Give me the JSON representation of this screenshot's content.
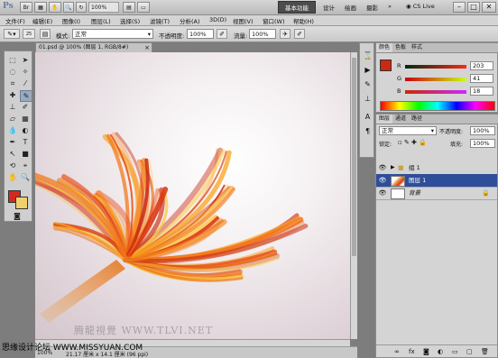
{
  "titlebar": {
    "logo": "Ps",
    "zoom": "100%",
    "workspace_active": "基本功能",
    "workspaces": [
      "设计",
      "绘画",
      "摄影"
    ],
    "cslive": "CS Live"
  },
  "menu": [
    "文件(F)",
    "编辑(E)",
    "图像(I)",
    "图层(L)",
    "选择(S)",
    "滤镜(T)",
    "分析(A)",
    "3D(D)",
    "视图(V)",
    "窗口(W)",
    "帮助(H)"
  ],
  "options": {
    "mode_label": "模式:",
    "mode_value": "正常",
    "opacity_label": "不透明度:",
    "opacity_value": "100%",
    "flow_label": "流量:",
    "flow_value": "100%",
    "brush_size": "25"
  },
  "document": {
    "tab_title": "01.psd @ 100% (图层 1, RGB/8#)",
    "status_zoom": "100%",
    "status_info": "21.17 厘米 x 14.1 厘米 (96 ppi)"
  },
  "color_panel": {
    "tabs": [
      "颜色",
      "色板",
      "样式"
    ],
    "r_label": "R",
    "g_label": "G",
    "b_label": "B",
    "r": "203",
    "g": "41",
    "b": "18"
  },
  "layers_panel": {
    "tabs": [
      "图层",
      "通道",
      "路径"
    ],
    "blend_mode": "正常",
    "opacity_label": "不透明度:",
    "opacity_value": "100%",
    "lock_label": "锁定:",
    "fill_label": "填充:",
    "fill_value": "100%",
    "layers": [
      {
        "name": "组 1"
      },
      {
        "name": "图层 1"
      },
      {
        "name": "背景"
      }
    ]
  },
  "watermarks": {
    "canvas": "腾龍視覺 WWW.TLVI.NET",
    "corner": "思缘设计论坛 WWW.MISSYUAN.COM"
  },
  "colors": {
    "foreground": "#d42a1e",
    "background": "#f1d06c",
    "selected_layer": "#2f4e9a"
  }
}
